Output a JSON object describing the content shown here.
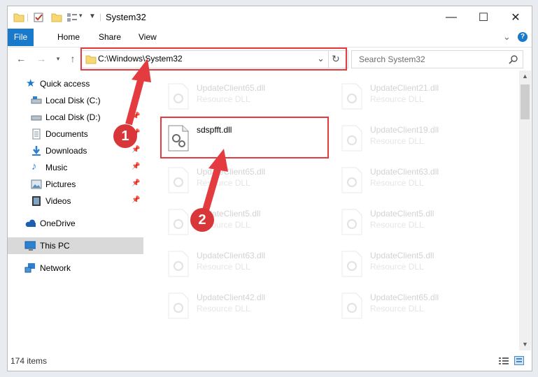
{
  "window": {
    "title": "System32"
  },
  "controls": {
    "minimize": "—",
    "maximize": "☐",
    "close": "✕"
  },
  "ribbon": {
    "tabs": [
      "File",
      "Home",
      "Share",
      "View"
    ],
    "help": "?",
    "collapse": "⌄"
  },
  "address": {
    "path": "C:\\Windows\\System32",
    "dropdown": "⌄",
    "refresh": "↻"
  },
  "search": {
    "placeholder": "Search System32"
  },
  "nav": {
    "quick_access": "Quick access",
    "items": [
      {
        "label": "Local Disk (C:)",
        "icon": "drive-icon",
        "pinned": true
      },
      {
        "label": "Local Disk (D:)",
        "icon": "drive-icon",
        "pinned": true
      },
      {
        "label": "Documents",
        "icon": "documents-icon",
        "pinned": true
      },
      {
        "label": "Downloads",
        "icon": "downloads-icon",
        "pinned": true
      },
      {
        "label": "Music",
        "icon": "music-icon",
        "pinned": true
      },
      {
        "label": "Pictures",
        "icon": "pictures-icon",
        "pinned": true
      },
      {
        "label": "Videos",
        "icon": "videos-icon",
        "pinned": true
      }
    ],
    "onedrive": "OneDrive",
    "this_pc": "This PC",
    "network": "Network"
  },
  "files": [
    {
      "name": "UpdateClient65.dll",
      "type": "Resource DLL",
      "highlighted": false
    },
    {
      "name": "UpdateClient21.dll",
      "type": "Resource DLL",
      "highlighted": false
    },
    {
      "name": "sdspfft.dll",
      "type": "",
      "highlighted": true
    },
    {
      "name": "UpdateClient19.dll",
      "type": "Resource DLL",
      "highlighted": false
    },
    {
      "name": "UpdateClient65.dll",
      "type": "Resource DLL",
      "highlighted": false
    },
    {
      "name": "UpdateClient63.dll",
      "type": "Resource DLL",
      "highlighted": false
    },
    {
      "name": "UpdateClient5.dll",
      "type": "Resource DLL",
      "highlighted": false
    },
    {
      "name": "UpdateClient5.dll",
      "type": "Resource DLL",
      "highlighted": false
    },
    {
      "name": "UpdateClient63.dll",
      "type": "Resource DLL",
      "highlighted": false
    },
    {
      "name": "UpdateClient5.dll",
      "type": "Resource DLL",
      "highlighted": false
    },
    {
      "name": "UpdateClient42.dll",
      "type": "Resource DLL",
      "highlighted": false
    },
    {
      "name": "UpdateClient65.dll",
      "type": "Resource DLL",
      "highlighted": false
    }
  ],
  "status": {
    "count": "174 items"
  },
  "annotations": {
    "step1": "1",
    "step2": "2",
    "color": "#e33b3f"
  }
}
